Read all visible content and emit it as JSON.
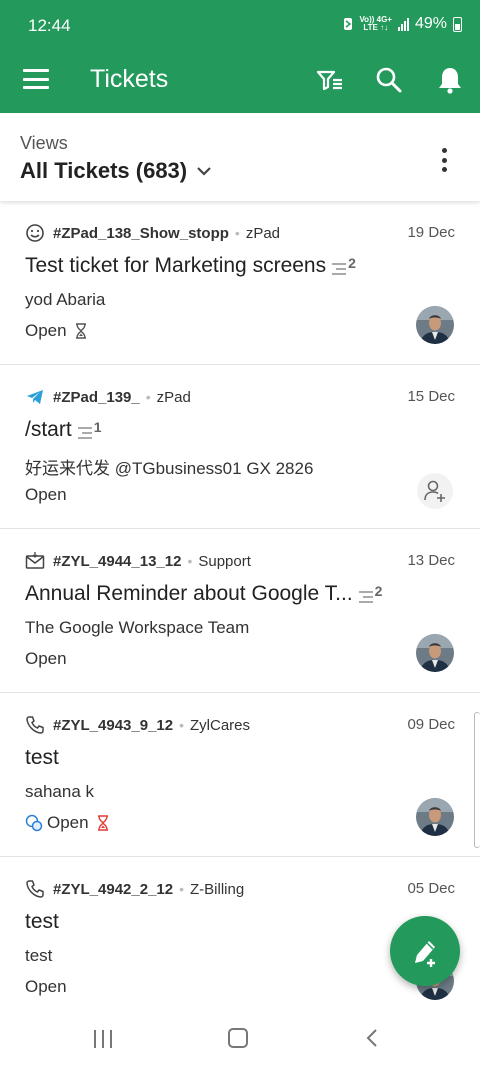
{
  "status_bar": {
    "time": "12:44",
    "network_top": "Vo)) 4G+",
    "network_bottom": "LTE ↑↓",
    "battery": "49%"
  },
  "app_bar": {
    "title": "Tickets",
    "icons": [
      "menu-icon",
      "filter-icon",
      "search-icon",
      "bell-icon"
    ]
  },
  "views": {
    "label": "Views",
    "selected": "All Tickets (683)"
  },
  "tickets": [
    {
      "channel": "chat-smiley-icon",
      "id": "#ZPad_138_Show_stopp",
      "department": "zPad",
      "date": "19 Dec",
      "subject": "Test ticket for Marketing screens",
      "thread_count": "2",
      "contact": "yod Abaria",
      "status": "Open",
      "indicator": "hourglass",
      "indicator_color": "#555555",
      "assignee": "avatar"
    },
    {
      "channel": "telegram-icon",
      "id": "#ZPad_139_",
      "department": "zPad",
      "date": "15 Dec",
      "subject": "/start",
      "thread_count": "1",
      "contact": "好运来代发 @TGbusiness01 GX 2826",
      "status": "Open",
      "indicator": "",
      "assignee": "assign"
    },
    {
      "channel": "email-icon",
      "id": "#ZYL_4944_13_12",
      "department": "Support",
      "date": "13 Dec",
      "subject": "Annual Reminder about Google T...",
      "thread_count": "2",
      "contact": "The Google Workspace Team",
      "status": "Open",
      "indicator": "",
      "assignee": "avatar"
    },
    {
      "channel": "phone-icon",
      "id": "#ZYL_4943_9_12",
      "department": "ZylCares",
      "date": "09 Dec",
      "subject": "test",
      "thread_count": "",
      "contact": "sahana k",
      "status": "Open",
      "indicator": "hourglass",
      "indicator_color": "#e53935",
      "assignee": "avatar"
    },
    {
      "channel": "phone-icon",
      "id": "#ZYL_4942_2_12",
      "department": "Z-Billing",
      "date": "05 Dec",
      "subject": "test",
      "thread_count": "",
      "contact": "test",
      "status": "Open",
      "indicator": "",
      "assignee": "avatar"
    }
  ],
  "fab": {
    "icon": "compose-ticket-icon"
  },
  "colors": {
    "brand": "#239a5c",
    "overdue": "#e53935"
  }
}
